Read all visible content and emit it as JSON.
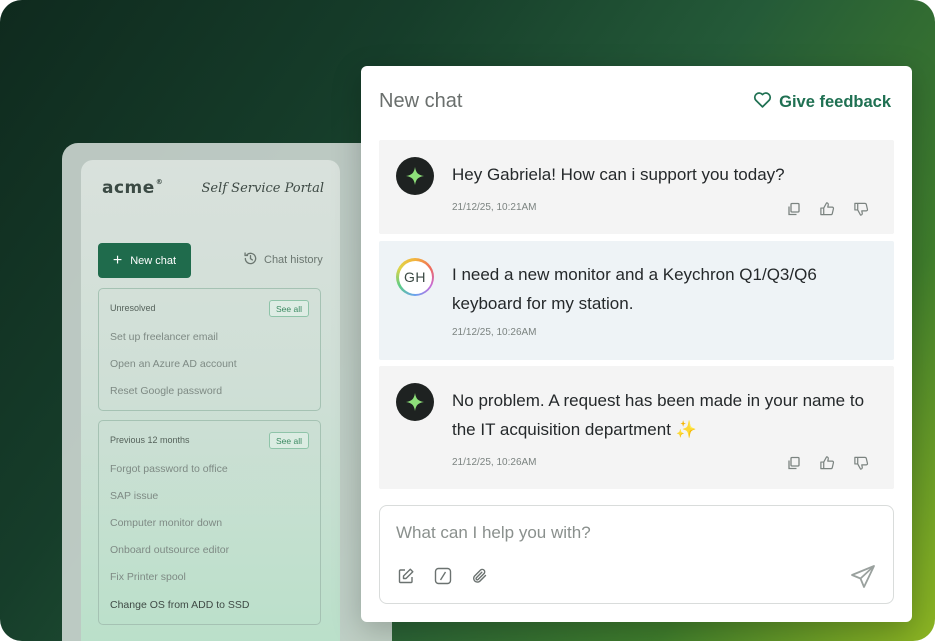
{
  "sidebar": {
    "logo": "acme",
    "logo_mark": "®",
    "portal_title": "Self Service Portal",
    "new_chat_label": "New chat",
    "history_label": "Chat history",
    "groups": [
      {
        "heading": "Unresolved",
        "see_all": "See all",
        "items": [
          "Set up freelancer email",
          "Open an Azure AD account",
          "Reset Google password"
        ]
      },
      {
        "heading": "Previous 12 months",
        "see_all": "See all",
        "items": [
          "Forgot password to office",
          "SAP issue",
          "Computer monitor down",
          "Onboard outsource editor",
          "Fix Printer spool",
          "Change OS from ADD to SSD"
        ]
      }
    ]
  },
  "chat": {
    "title": "New chat",
    "feedback_label": "Give feedback",
    "messages": [
      {
        "role": "assistant",
        "text": "Hey Gabriela! How can i support you today?",
        "time": "21/12/25, 10:21AM"
      },
      {
        "role": "user",
        "initials": "GH",
        "text": "I need a new monitor and a Keychron Q1/Q3/Q6 keyboard for my station.",
        "time": "21/12/25, 10:26AM"
      },
      {
        "role": "assistant",
        "text": "No problem. A request has been made in your name to the IT acquisition department ✨",
        "time": "21/12/25, 10:26AM"
      }
    ],
    "composer": {
      "placeholder": "What can I help you with?",
      "value": ""
    }
  },
  "colors": {
    "accent": "#1f6b4c",
    "feedback": "#1f7052",
    "bot_bubble": "#f4f4f4",
    "user_bubble": "#eef3f6",
    "sparkle": "#8ee07a"
  },
  "icons": {
    "bot_avatar": "sparkle-icon",
    "actions": [
      "copy-icon",
      "thumbs-up-icon",
      "thumbs-down-icon"
    ],
    "tools": [
      "edit-icon",
      "slash-command-icon",
      "paperclip-icon"
    ],
    "send": "send-icon",
    "feedback": "heart-icon",
    "history": "history-icon",
    "new_chat": "plus-icon"
  }
}
